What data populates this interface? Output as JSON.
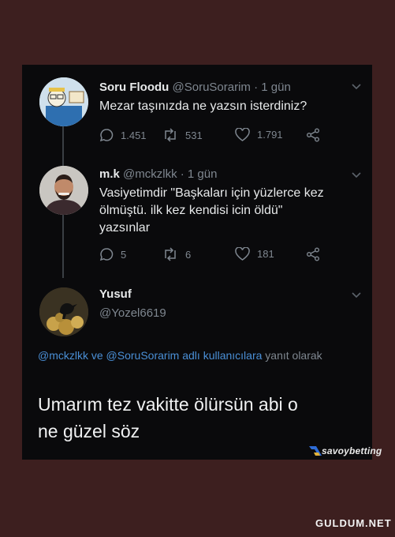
{
  "tweets": [
    {
      "name": "Soru Floodu",
      "handle": "@SoruSorarim · 1 gün",
      "text": "Mezar taşınızda ne yazsın isterdiniz?",
      "reply_count": "1.451",
      "retweet_count": "531",
      "like_count": "1.791"
    },
    {
      "name": "m.k",
      "handle": "@mckzlkk · 1 gün",
      "text_lines": [
        "Vasiyetimdir \"Başkaları için yüzlerce kez",
        "ölmüştü. ilk kez kendisi icin öldü\"",
        "yazsınlar"
      ],
      "reply_count": "5",
      "retweet_count": "6",
      "like_count": "181"
    },
    {
      "name": "Yusuf",
      "handle": "@Yozel6619",
      "replying_mention": "@mckzlkk ve @SoruSorarim adlı kullanıcılara",
      "replying_rest": " yanıt olarak",
      "text_lines": [
        "Umarım tez vakitte ölürsün abi o",
        "ne güzel söz"
      ]
    }
  ],
  "watermark": "savoybetting",
  "site_watermark": "GULDUM.NET",
  "icons": [
    "reply-icon",
    "retweet-icon",
    "like-icon",
    "share-icon",
    "chevron-down-icon"
  ],
  "colors": {
    "background": "#0a0a0c",
    "frame": "#3d1f1f",
    "mention": "#4a8fd6",
    "muted": "#7f8790"
  }
}
